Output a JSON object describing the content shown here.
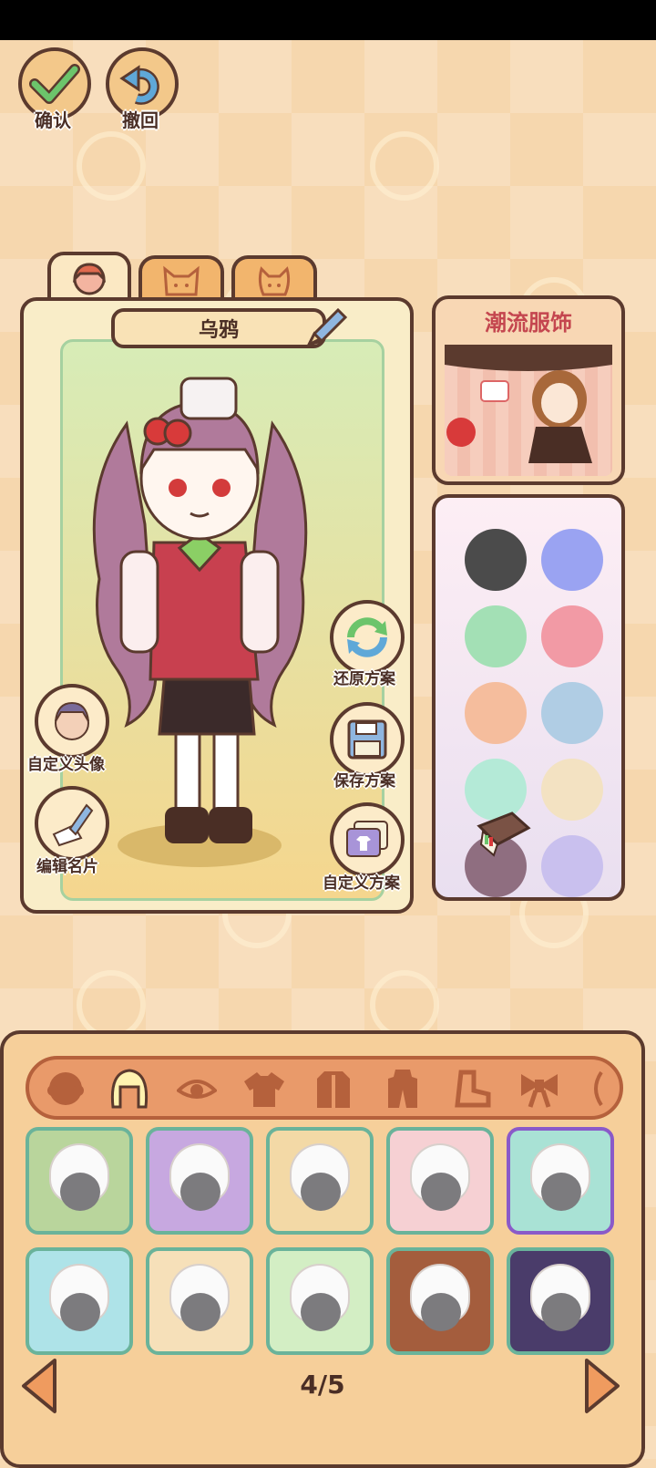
{
  "top_buttons": {
    "confirm_label": "确认",
    "undo_label": "撤回"
  },
  "tabs": [
    {
      "name": "character-tab",
      "icon": "girl-face-icon"
    },
    {
      "name": "cat-tab",
      "icon": "cat-face-icon"
    },
    {
      "name": "dog-tab",
      "icon": "dog-face-icon"
    }
  ],
  "character": {
    "name": "乌鸦"
  },
  "side_actions": {
    "restore_label": "还原方案",
    "save_label": "保存方案",
    "custom_scheme_label": "自定义方案",
    "custom_avatar_label": "自定义头像",
    "edit_card_label": "编辑名片"
  },
  "promo": {
    "title": "潮流服饰"
  },
  "palette": {
    "colors": [
      "#4b4b4b",
      "#9aa3f2",
      "#a3e0b5",
      "#f29aa5",
      "#f5bd9d",
      "#b0cde4",
      "#b4ead7",
      "#f3e2c2",
      "#8f6e80",
      "#c9c0ee"
    ]
  },
  "categories": [
    "face",
    "hair",
    "eyes",
    "top",
    "coat",
    "outfit",
    "shoes",
    "bow"
  ],
  "items": {
    "row1": [
      "#b9d59c",
      "#c7a8e0",
      "#f3d9a6",
      "#f6d0d3",
      "#a9e2d5"
    ],
    "row2": [
      "#aee3e8",
      "#f6e0b9",
      "#d3eec4",
      "#a45d3d",
      "#4a3c6a"
    ]
  },
  "pager": {
    "text": "4/5"
  },
  "accent_colors": {
    "outline": "#5b3a2e",
    "item_border": "#6ab39a",
    "selected_border": "#8a5ac9"
  }
}
